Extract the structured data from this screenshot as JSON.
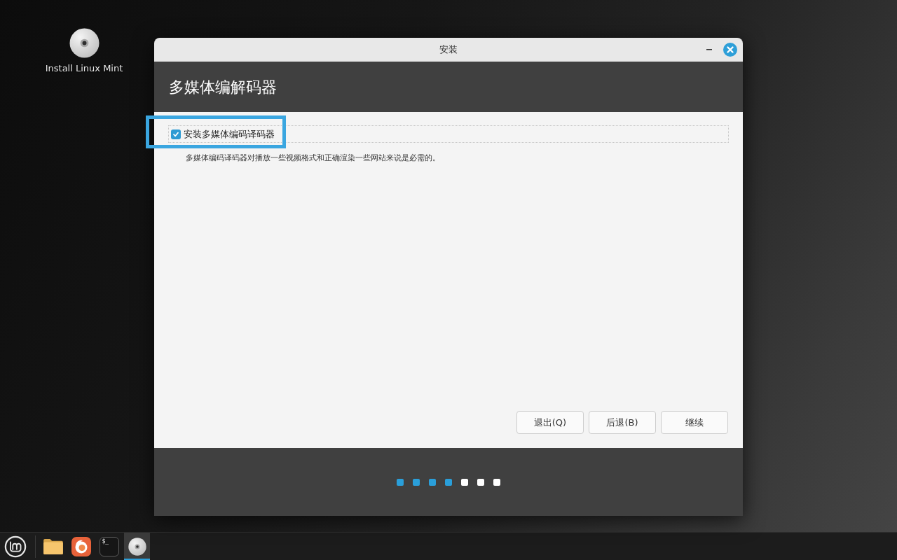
{
  "desktop": {
    "icons": [
      {
        "label": "Install Linux Mint"
      }
    ]
  },
  "window": {
    "title": "安装",
    "heading": "多媒体编解码器",
    "option": {
      "label": "安装多媒体编码译码器",
      "checked": true,
      "highlighted": true
    },
    "description": "多媒体编码译码器对播放一些视频格式和正确渲染一些网站来说是必需的。",
    "buttons": [
      {
        "label": "退出(Q)"
      },
      {
        "label": "后退(B)"
      },
      {
        "label": "继续"
      }
    ],
    "steps": [
      {
        "done": true
      },
      {
        "done": true
      },
      {
        "done": true
      },
      {
        "done": true
      },
      {
        "done": false
      },
      {
        "done": false
      },
      {
        "done": false
      }
    ]
  },
  "taskbar": {
    "items": [
      {
        "kind": "files",
        "active": false
      },
      {
        "kind": "browser",
        "active": false
      },
      {
        "kind": "terminal",
        "glyph": "$_",
        "active": false
      },
      {
        "kind": "installer",
        "active": true
      }
    ]
  }
}
